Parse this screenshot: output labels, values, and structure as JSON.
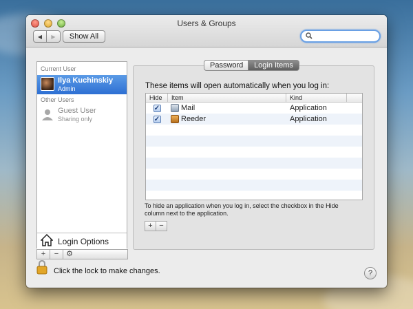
{
  "window": {
    "title": "Users & Groups"
  },
  "toolbar": {
    "back_glyph": "◀",
    "forward_glyph": "▶",
    "show_all_label": "Show All",
    "search_placeholder": ""
  },
  "sidebar": {
    "current_user_header": "Current User",
    "current_user": {
      "name": "Ilya Kuchinskiy",
      "role": "Admin"
    },
    "other_users_header": "Other Users",
    "other_users": [
      {
        "name": "Guest User",
        "role": "Sharing only"
      }
    ],
    "login_options_label": "Login Options",
    "add_glyph": "+",
    "remove_glyph": "−",
    "gear_glyph": "⚙"
  },
  "tabs": [
    {
      "label": "Password",
      "active": false
    },
    {
      "label": "Login Items",
      "active": true
    }
  ],
  "login_items": {
    "description": "These items will open automatically when you log in:",
    "columns": {
      "hide": "Hide",
      "item": "Item",
      "kind": "Kind"
    },
    "rows": [
      {
        "hide": true,
        "name": "Mail",
        "kind": "Application",
        "icon": "mail-icon"
      },
      {
        "hide": true,
        "name": "Reeder",
        "kind": "Application",
        "icon": "reeder-icon"
      }
    ],
    "help_text": "To hide an application when you log in, select the checkbox in the Hide column next to the application.",
    "add_glyph": "+",
    "remove_glyph": "−",
    "check_glyph": "✓"
  },
  "footer": {
    "lock_text": "Click the lock to make changes.",
    "help_glyph": "?"
  },
  "colors": {
    "selection": "#2d6fd3",
    "search_focus": "#6aa0e4"
  }
}
